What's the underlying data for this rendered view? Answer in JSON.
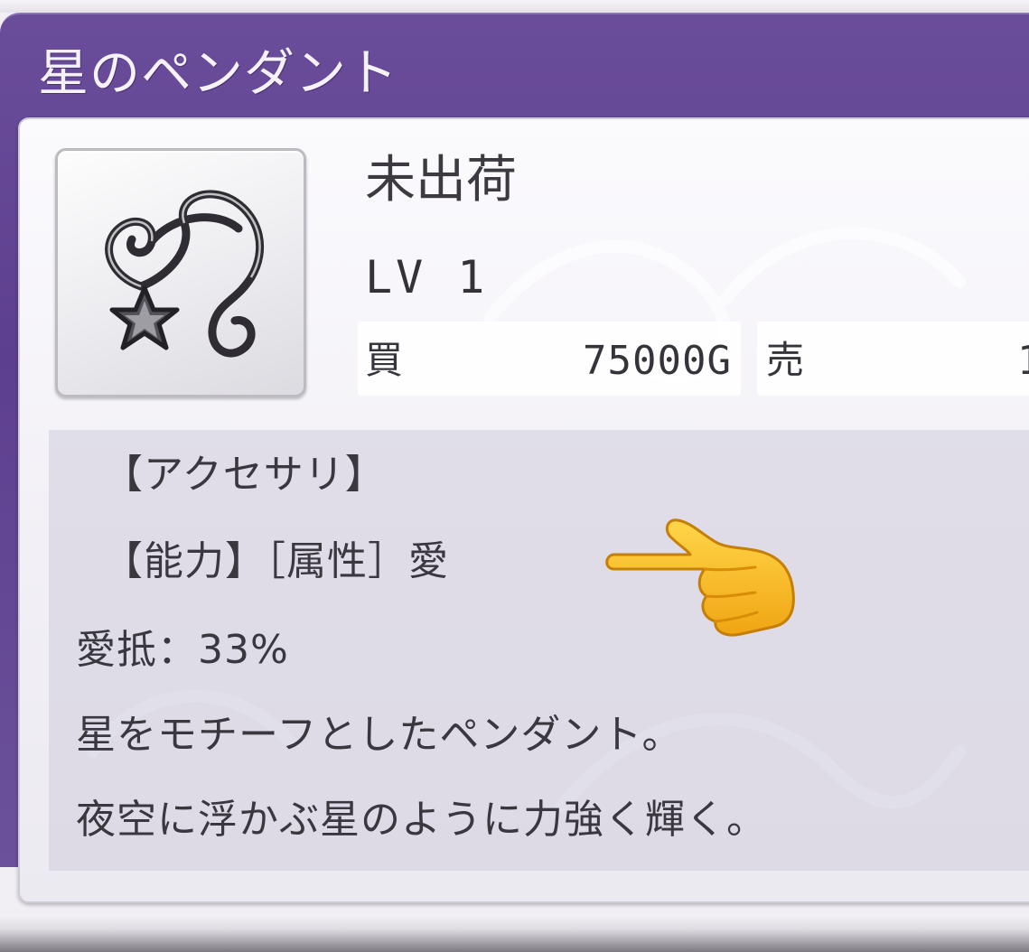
{
  "item": {
    "name": "星のペンダント",
    "status": "未出荷",
    "level": "LV 1",
    "buy_label": "買",
    "buy_price": "75000G",
    "sell_label": "売",
    "sell_price": "1"
  },
  "description": {
    "category": "【アクセサリ】",
    "ability": "【能力】［属性］愛",
    "resistance": "愛抵：33%",
    "line1": "星をモチーフとしたペンダント。",
    "line2": "夜空に浮かぶ星のように力強く輝く。"
  },
  "icons": {
    "item_icon": "star-pendant-icon",
    "pointer": "pointing-hand-emoji"
  },
  "colors": {
    "title_bar": "#5d3f8f",
    "panel": "#f2f0f6",
    "text": "#3a383e",
    "emoji": "#f7b614"
  }
}
